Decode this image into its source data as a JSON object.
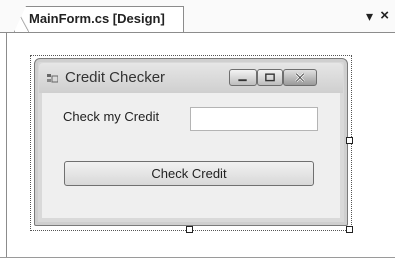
{
  "document_tab": {
    "title": "MainForm.cs [Design]",
    "pin_glyph": "▾",
    "close_glyph": "×"
  },
  "form": {
    "title": "Credit Checker",
    "icon": "form-icon",
    "window_buttons": [
      "minimize-icon",
      "maximize-icon",
      "close-icon"
    ],
    "label_text": "Check my Credit",
    "textbox_value": "",
    "button_label": "Check Credit"
  },
  "colors": {
    "surface": "#efefef",
    "frame": "#d9d9d9",
    "border": "#7a7a7a"
  }
}
